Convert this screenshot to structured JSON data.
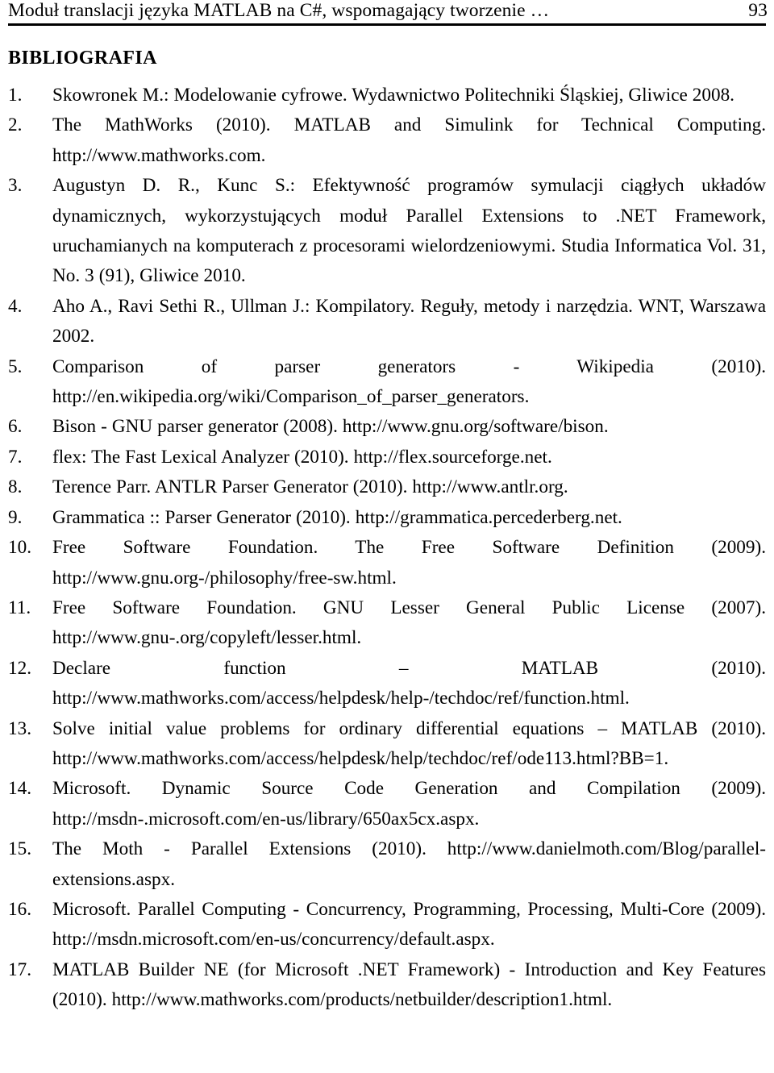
{
  "running_head": {
    "title": "Moduł translacji języka MATLAB na C#, wspomagający tworzenie …",
    "page_number": "93"
  },
  "section": {
    "heading": "BIBLIOGRAFIA"
  },
  "bibliography": {
    "entries": [
      {
        "number": "1.",
        "text": "Skowronek M.: Modelowanie cyfrowe. Wydawnictwo Politechniki Śląskiej, Gliwice 2008."
      },
      {
        "number": "2.",
        "text": "The MathWorks (2010). MATLAB and Simulink for Technical Computing. http://www.mathworks.com."
      },
      {
        "number": "3.",
        "text": "Augustyn D. R., Kunc S.: Efektywność programów symulacji ciągłych układów dynamicznych, wykorzystujących moduł Parallel Extensions to .NET Framework, uruchamianych na komputerach z procesorami wielordzeniowymi. Studia Informatica Vol. 31, No. 3 (91), Gliwice 2010."
      },
      {
        "number": "4.",
        "text": "Aho A., Ravi Sethi R., Ullman J.: Kompilatory. Reguły, metody i narzędzia. WNT, Warszawa 2002."
      },
      {
        "number": "5.",
        "text": "Comparison of parser generators - Wikipedia (2010). http://en.wikipedia.org/wiki/Comparison_of_parser_generators."
      },
      {
        "number": "6.",
        "text": "Bison - GNU parser generator (2008). http://www.gnu.org/software/bison."
      },
      {
        "number": "7.",
        "text": "flex: The Fast Lexical Analyzer (2010). http://flex.sourceforge.net."
      },
      {
        "number": "8.",
        "text": "Terence Parr. ANTLR Parser Generator (2010). http://www.antlr.org."
      },
      {
        "number": "9.",
        "text": "Grammatica :: Parser Generator (2010). http://grammatica.percederberg.net."
      },
      {
        "number": "10.",
        "text": "Free Software Foundation. The Free Software Definition (2009). http://www.gnu.org-/philosophy/free-sw.html."
      },
      {
        "number": "11.",
        "text": "Free Software Foundation. GNU Lesser General Public License (2007). http://www.gnu-.org/copyleft/lesser.html."
      },
      {
        "number": "12.",
        "text": "Declare function – MATLAB (2010). http://www.mathworks.com/access/helpdesk/help-/techdoc/ref/function.html."
      },
      {
        "number": "13.",
        "text": "Solve initial value problems for ordinary differential equations – MATLAB (2010). http://www.mathworks.com/access/helpdesk/help/techdoc/ref/ode113.html?BB=1."
      },
      {
        "number": "14.",
        "text": "Microsoft. Dynamic Source Code Generation and Compilation (2009). http://msdn-.microsoft.com/en-us/library/650ax5cx.aspx."
      },
      {
        "number": "15.",
        "text": "The Moth - Parallel Extensions (2010). http://www.danielmoth.com/Blog/parallel-extensions.aspx."
      },
      {
        "number": "16.",
        "text": "Microsoft. Parallel Computing - Concurrency, Programming, Processing, Multi-Core (2009). http://msdn.microsoft.com/en-us/concurrency/default.aspx."
      },
      {
        "number": "17.",
        "text": "MATLAB Builder NE (for Microsoft .NET Framework) - Introduction and Key Features (2010). http://www.mathworks.com/products/netbuilder/description1.html."
      }
    ]
  }
}
